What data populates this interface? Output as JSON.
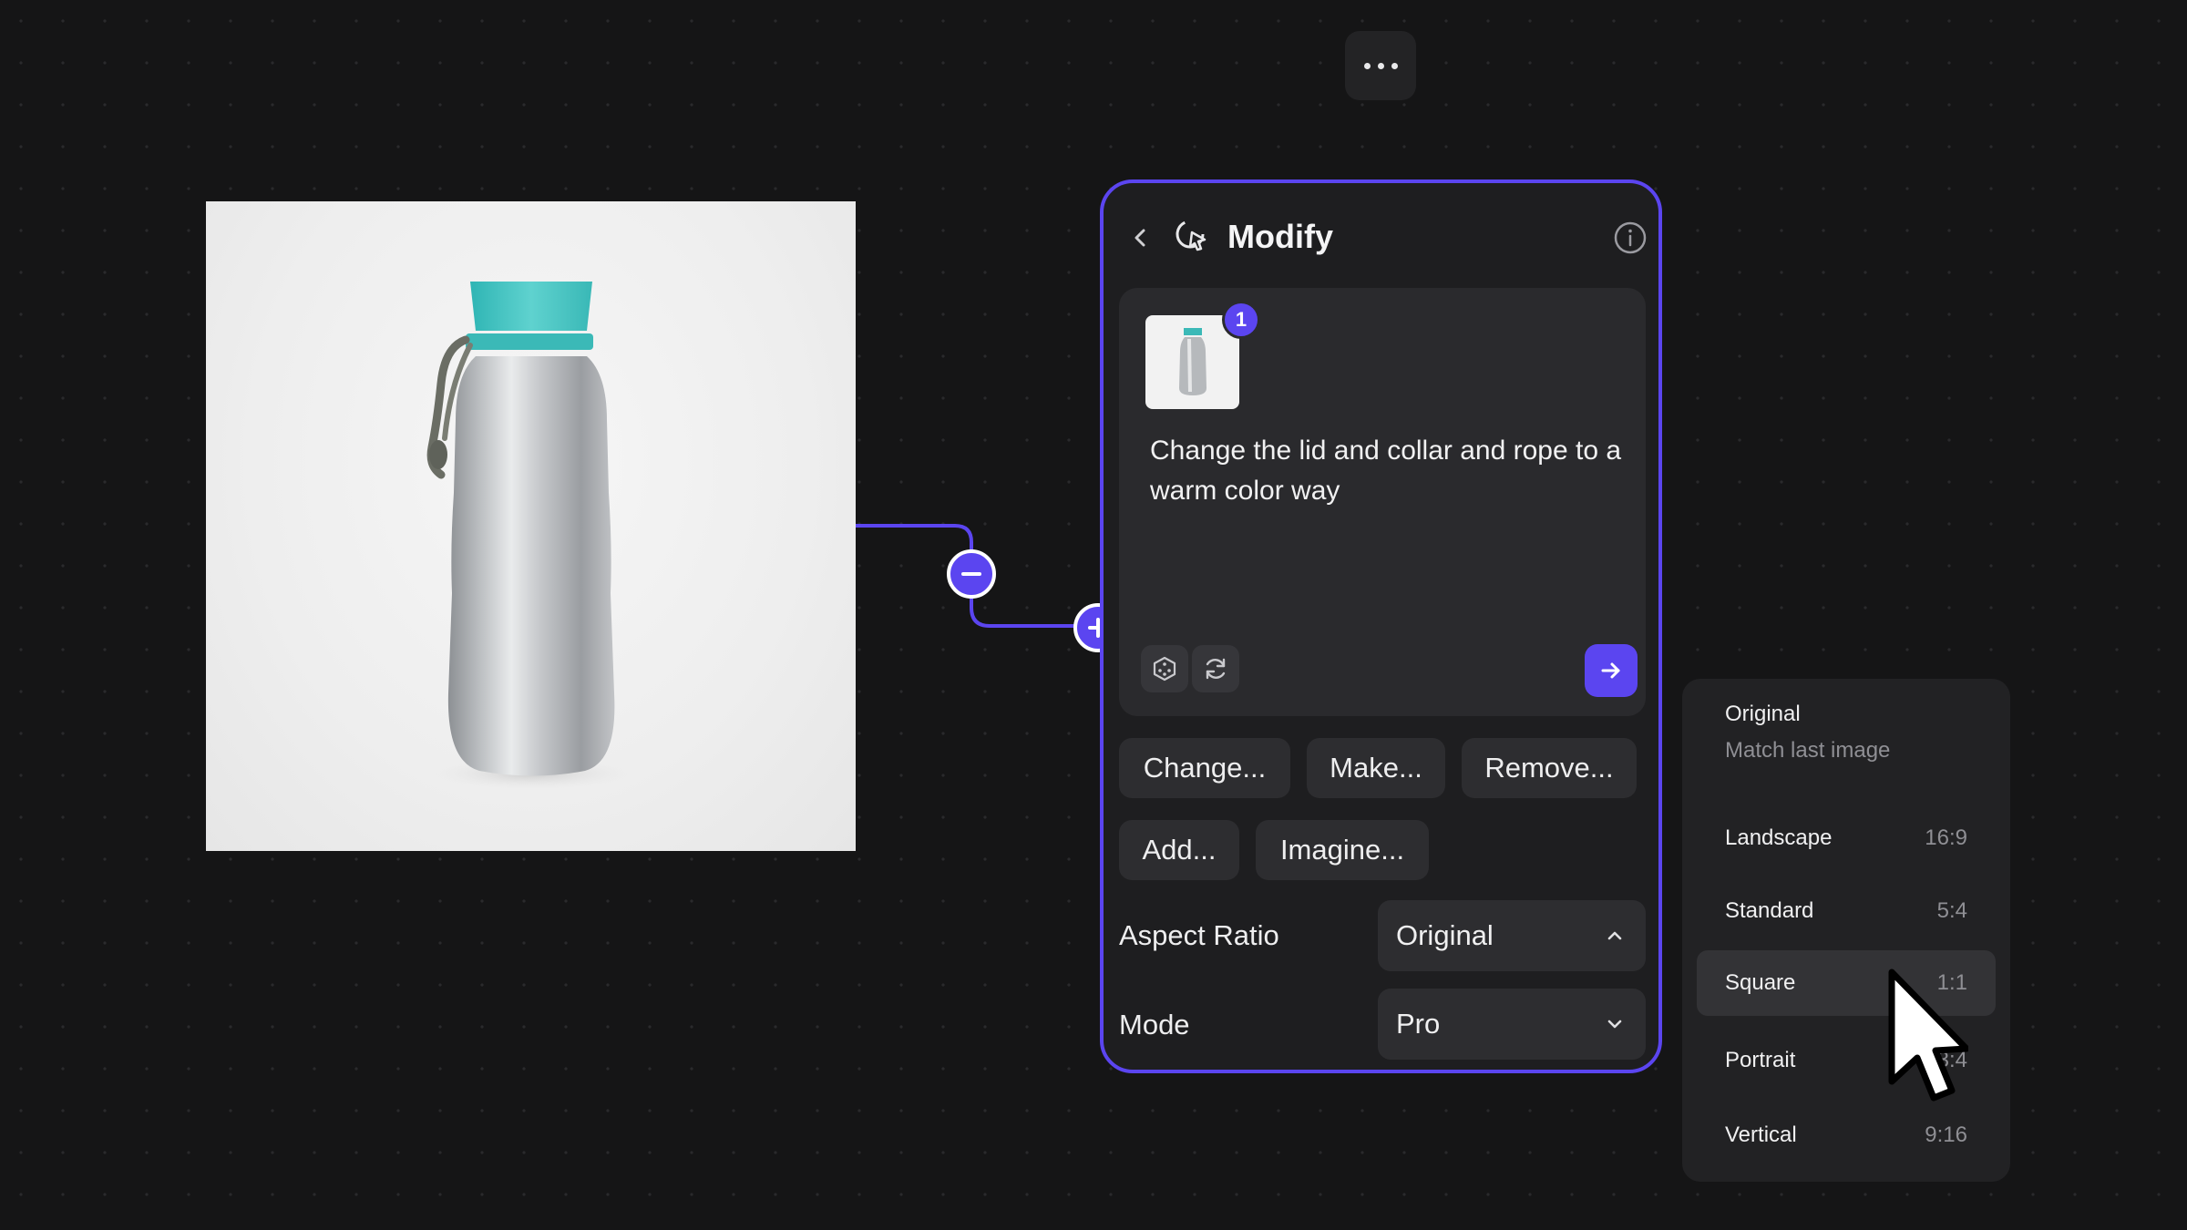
{
  "canvas": {
    "background": "#151516",
    "accent": "#5b45f0"
  },
  "toolbar": {
    "more_icon": "more-horizontal-icon"
  },
  "image_node": {
    "subject_icon": "water-bottle-image"
  },
  "panel": {
    "title": "Modify",
    "back_icon": "chevron-left-icon",
    "title_icon": "cursor-sparkle-icon",
    "info_icon": "info-icon",
    "prompt": {
      "badge_count": "1",
      "text": "Change the lid and collar and rope to a warm color way",
      "random_icon": "dice-icon",
      "refresh_icon": "refresh-icon",
      "send_icon": "arrow-right-icon"
    },
    "chips": {
      "change": "Change...",
      "make": "Make...",
      "remove": "Remove...",
      "add": "Add...",
      "imagine": "Imagine..."
    },
    "aspect_ratio": {
      "label": "Aspect Ratio",
      "value": "Original",
      "icon": "chevron-up-icon"
    },
    "mode": {
      "label": "Mode",
      "value": "Pro",
      "icon": "chevron-down-icon"
    }
  },
  "dropdown": {
    "options": [
      {
        "name": "Original",
        "subtitle": "Match last image"
      },
      {
        "name": "Landscape",
        "ratio": "16:9"
      },
      {
        "name": "Standard",
        "ratio": "5:4"
      },
      {
        "name": "Square",
        "ratio": "1:1"
      },
      {
        "name": "Portrait",
        "ratio": "3:4"
      },
      {
        "name": "Vertical",
        "ratio": "9:16"
      }
    ],
    "highlighted": "Square"
  }
}
